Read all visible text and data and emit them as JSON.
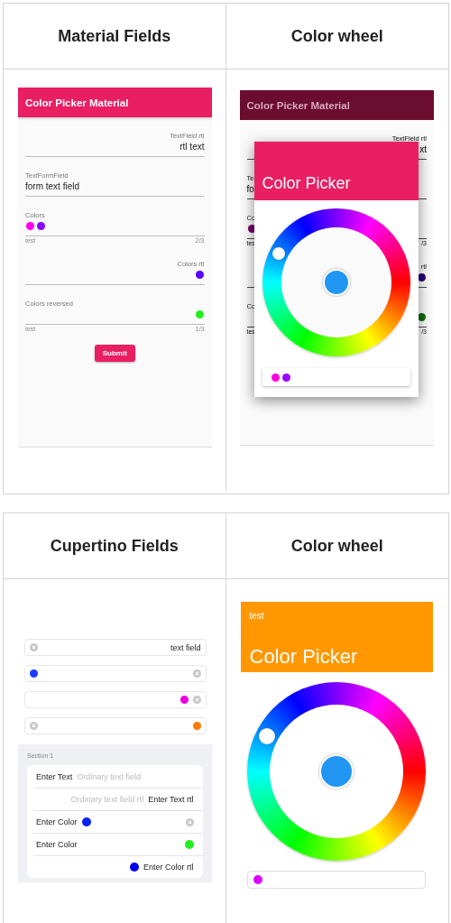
{
  "material_table": {
    "headers": [
      "Material Fields",
      "Color wheel"
    ],
    "form": {
      "app_bar_title": "Color Picker Material",
      "fields": [
        {
          "kind": "text",
          "label": "TextField rtl",
          "label_end": true,
          "value": "rtl text",
          "value_end": true
        },
        {
          "kind": "text",
          "label": "TextFormField",
          "label_end": false,
          "value": "form text field",
          "value_end": false
        },
        {
          "kind": "colors",
          "label": "Colors",
          "label_end": false,
          "colors": [
            {
              "color": "#ff00ee"
            },
            {
              "color": "#8800ff"
            }
          ],
          "value_end": false,
          "helper": "test",
          "counter": "2/3"
        },
        {
          "kind": "colors",
          "label": "Colors rtl",
          "label_end": true,
          "colors": [
            {
              "color": "#5500ff"
            }
          ],
          "value_end": true
        },
        {
          "kind": "colors",
          "label": "Colors reversed",
          "label_end": false,
          "colors": [
            {
              "color": "#22ee22"
            }
          ],
          "value_end": true,
          "helper": "test",
          "counter": "1/3"
        }
      ],
      "submit": "Submit"
    },
    "dialog_view": {
      "background": {
        "app_bar_title": "Color Picker Material",
        "fields": [
          {
            "kind": "text",
            "label": "TextField rtl",
            "label_end": true,
            "value": "xt",
            "value_end": true
          },
          {
            "kind": "text",
            "label": "Te",
            "label_end": false,
            "value": "fo",
            "value_end": false
          },
          {
            "kind": "colors",
            "label": "Co",
            "label_end": false,
            "colors": [
              {
                "color": "#730069"
              }
            ],
            "value_end": false,
            "helper": "tes",
            "counter": "/3"
          },
          {
            "kind": "colors",
            "label": "rtl",
            "label_end": true,
            "colors": [
              {
                "color": "#270073"
              }
            ],
            "value_end": true
          },
          {
            "kind": "colors",
            "label": "Co",
            "label_end": false,
            "colors": [
              {
                "color": "#0f6b0f"
              }
            ],
            "value_end": true,
            "helper": "tes",
            "counter": "/3"
          }
        ]
      },
      "dialog": {
        "title": "Color Picker",
        "wheel": {
          "color": "#2196f3"
        },
        "chips": [
          {
            "color": "#ff00dd"
          },
          {
            "color": "#9900ff"
          }
        ]
      }
    }
  },
  "cupertino_table": {
    "headers": [
      "Cupertino Fields",
      "Color wheel"
    ],
    "fields": [
      {
        "start": [
          {
            "kind": "clear"
          }
        ],
        "end": [
          {
            "kind": "text",
            "text": "text field"
          }
        ]
      },
      {
        "start": [
          {
            "kind": "dot",
            "color": "#1a3cff"
          }
        ],
        "end": [
          {
            "kind": "clear"
          }
        ]
      },
      {
        "end": [
          {
            "kind": "dot",
            "color": "#ee00dd"
          },
          {
            "kind": "clear"
          }
        ]
      },
      {
        "start": [
          {
            "kind": "clear"
          }
        ],
        "end": [
          {
            "kind": "dot",
            "color": "#ff7a00"
          }
        ]
      }
    ],
    "section": {
      "title": "Section 1",
      "rows": [
        {
          "start": [
            {
              "kind": "label",
              "text": "Enter Text"
            },
            {
              "kind": "placeholder",
              "text": "Ordinary text field"
            }
          ]
        },
        {
          "end": [
            {
              "kind": "placeholder",
              "text": "Ordinary text field rtl"
            },
            {
              "kind": "label",
              "text": "Enter Text rtl"
            }
          ]
        },
        {
          "start": [
            {
              "kind": "label",
              "text": "Enter Color"
            },
            {
              "kind": "dot",
              "color": "#0022ee"
            }
          ],
          "end": [
            {
              "kind": "clear"
            }
          ]
        },
        {
          "start": [
            {
              "kind": "label",
              "text": "Enter Color"
            }
          ],
          "end": [
            {
              "kind": "dot",
              "color": "#22ee22"
            }
          ]
        },
        {
          "end": [
            {
              "kind": "dot",
              "color": "#0000ee"
            },
            {
              "kind": "label",
              "text": "Enter Color rtl"
            }
          ]
        }
      ]
    },
    "picker": {
      "subtitle": "test",
      "title": "Color Picker",
      "wheel": {
        "color": "#2196f3"
      },
      "chips": [
        {
          "color": "#dd00ff"
        }
      ]
    }
  }
}
